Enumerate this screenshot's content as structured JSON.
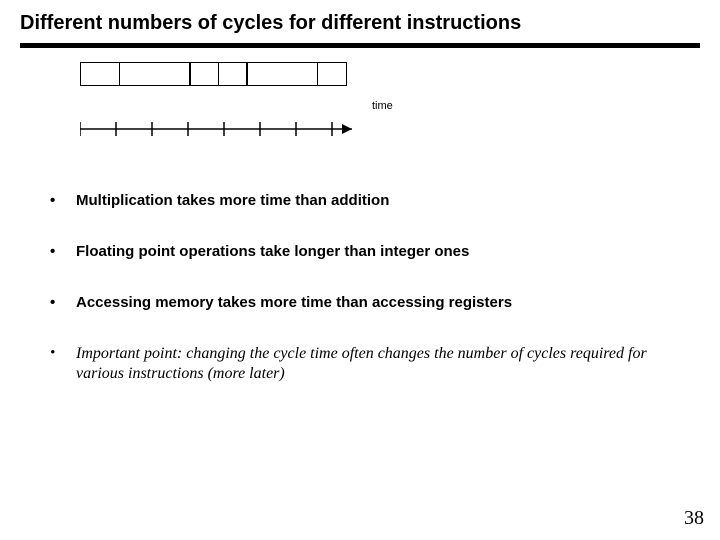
{
  "title": "Different numbers of cycles for different instructions",
  "time_label": "time",
  "box_widths": [
    40,
    72,
    30,
    30,
    72,
    30
  ],
  "timeline_ticks": 8,
  "bullets": [
    {
      "text": "Multiplication takes more time than addition",
      "style": "bold"
    },
    {
      "text": "Floating point operations take longer than integer ones",
      "style": "bold"
    },
    {
      "text": "Accessing memory takes more time than accessing registers",
      "style": "bold"
    },
    {
      "text": " Important point:  changing the cycle time often changes the number of cycles required for various instructions (more later)",
      "style": "italic"
    }
  ],
  "page_number": "38"
}
